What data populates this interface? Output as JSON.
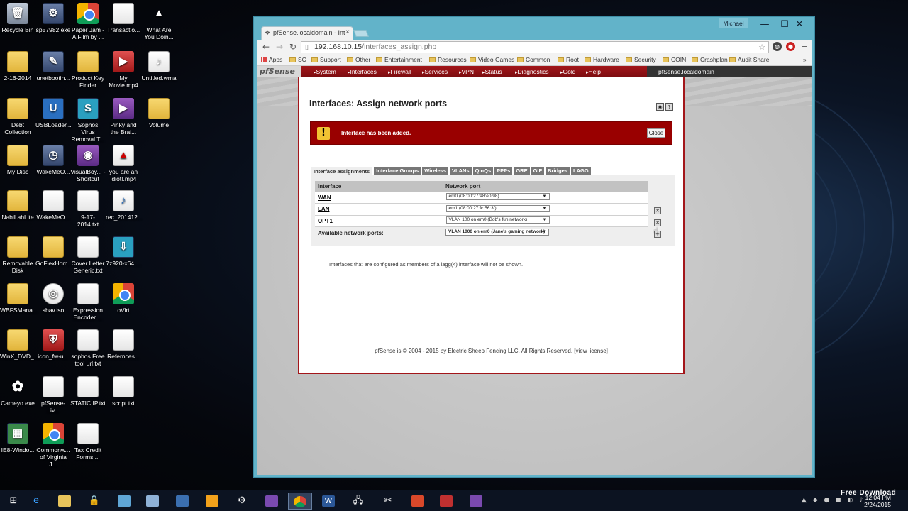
{
  "desktop": {
    "icons": [
      {
        "label": "Recycle Bin"
      },
      {
        "label": "sp57982.exe"
      },
      {
        "label": "Paper Jam - A Film by ..."
      },
      {
        "label": "Transactio..."
      },
      {
        "label": "What Are You Doin..."
      },
      {
        "label": "2-16-2014"
      },
      {
        "label": "unetbootin..."
      },
      {
        "label": "Product Key Finder"
      },
      {
        "label": "My Movie.mp4"
      },
      {
        "label": "Untitled.wma"
      },
      {
        "label": "Debt Collection"
      },
      {
        "label": "USBLoader..."
      },
      {
        "label": "Sophos Virus Removal T..."
      },
      {
        "label": "Pinky and the Brai..."
      },
      {
        "label": "Volume"
      },
      {
        "label": "My Disc"
      },
      {
        "label": "WakeMeO..."
      },
      {
        "label": "VisualBoy... - Shortcut"
      },
      {
        "label": "you are an idiot!.mp4"
      },
      {
        "label": "NabiLabLite"
      },
      {
        "label": "WakeMeO..."
      },
      {
        "label": "9-17-2014.txt"
      },
      {
        "label": "rec_201412..."
      },
      {
        "label": "Removable Disk"
      },
      {
        "label": "GoFlexHom..."
      },
      {
        "label": "Cover Letter Generic.txt"
      },
      {
        "label": "7z920-x64...."
      },
      {
        "label": "WBFSMana..."
      },
      {
        "label": "sbav.iso"
      },
      {
        "label": "Expression Encoder ..."
      },
      {
        "label": "oVirt"
      },
      {
        "label": "WinX_DVD_..."
      },
      {
        "label": "icon_fw-u..."
      },
      {
        "label": "sophos Free tool url.txt"
      },
      {
        "label": "Refernces..."
      },
      {
        "label": "Cameyo.exe"
      },
      {
        "label": "pfSense-Liv..."
      },
      {
        "label": "STATIC IP.txt"
      },
      {
        "label": "script.txt"
      },
      {
        "label": "IE8-Windo..."
      },
      {
        "label": "Commonw... of Virginia J..."
      },
      {
        "label": "Tax Credit Forms ..."
      }
    ]
  },
  "browser": {
    "tab_title": "pfSense.localdomain - Int",
    "user": "Michael",
    "url_host": "192.168.10.15",
    "url_path": "/interfaces_assign.php",
    "bookmarks": [
      "Apps",
      "SC",
      "Support",
      "Other",
      "Entertainment",
      "Resources",
      "Video Games",
      "Common",
      "Root",
      "Hardware",
      "Security",
      "COIN",
      "Crashplan",
      "Audit Share"
    ]
  },
  "pfsense": {
    "logo": "pfSense",
    "menu": [
      "System",
      "Interfaces",
      "Firewall",
      "Services",
      "VPN",
      "Status",
      "Diagnostics",
      "Gold",
      "Help"
    ],
    "hostname": "pfSense.localdomain",
    "page_title": "Interfaces: Assign network ports",
    "alert_message": "Interface has been added.",
    "alert_close": "Close",
    "tabs": [
      "Interface assignments",
      "Interface Groups",
      "Wireless",
      "VLANs",
      "QinQs",
      "PPPs",
      "GRE",
      "GIF",
      "Bridges",
      "LAGG"
    ],
    "table": {
      "headers": [
        "Interface",
        "Network port"
      ],
      "rows": [
        {
          "name": "WAN",
          "port": "em0 (08:00:27:a8:e0:98)"
        },
        {
          "name": "LAN",
          "port": "em1 (08:00:27:fc:56:3f)"
        },
        {
          "name": "OPT1",
          "port": "VLAN 100 on em0 (Bob's fun network)"
        }
      ],
      "available_label": "Available network ports:",
      "available_value": "VLAN 1000 on em0 (Jane's gaming network)"
    },
    "note": "Interfaces that are configured as members of a lagg(4) interface will not be shown.",
    "footer": "pfSense is © 2004 - 2015 by Electric Sheep Fencing LLC. All Rights Reserved.",
    "footer_link": "[view license]"
  },
  "taskbar": {
    "time": "12:04 PM",
    "date": "2/24/2015",
    "watermark": "Free Download"
  }
}
